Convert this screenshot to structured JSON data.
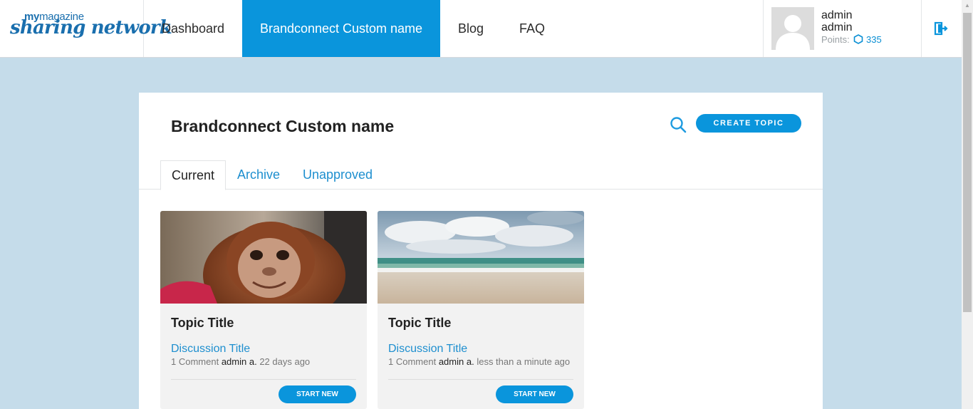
{
  "logo": {
    "line1_my": "my",
    "line1_rest": "magazine",
    "line2": "sharing network"
  },
  "nav": {
    "items": [
      {
        "label": "Dashboard"
      },
      {
        "label": "Brandconnect Custom name",
        "active": true
      },
      {
        "label": "Blog"
      },
      {
        "label": "FAQ"
      }
    ]
  },
  "user": {
    "first_name": "admin",
    "last_name": "admin",
    "points_label": "Points:",
    "points_value": "335"
  },
  "page": {
    "title": "Brandconnect Custom name",
    "create_button": "CREATE TOPIC",
    "tabs": [
      {
        "label": "Current",
        "active": true
      },
      {
        "label": "Archive"
      },
      {
        "label": "Unapproved"
      }
    ]
  },
  "cards": [
    {
      "image": "orangutan-photo",
      "title": "Topic Title",
      "discussion": "Discussion Title",
      "comments": "1 Comment",
      "author": "admin a.",
      "time": "22 days ago",
      "button": "START NEW"
    },
    {
      "image": "beach-photo",
      "title": "Topic Title",
      "discussion": "Discussion Title",
      "comments": "1 Comment",
      "author": "admin a.",
      "time": "less than a minute ago",
      "button": "START NEW"
    }
  ],
  "colors": {
    "accent": "#0a95dc",
    "page_background": "#c5dcea",
    "link": "#1e8fcf",
    "card_background": "#f2f2f2"
  },
  "icons": [
    "search-icon",
    "logout-icon",
    "points-hexagon-icon",
    "avatar-placeholder-icon"
  ]
}
